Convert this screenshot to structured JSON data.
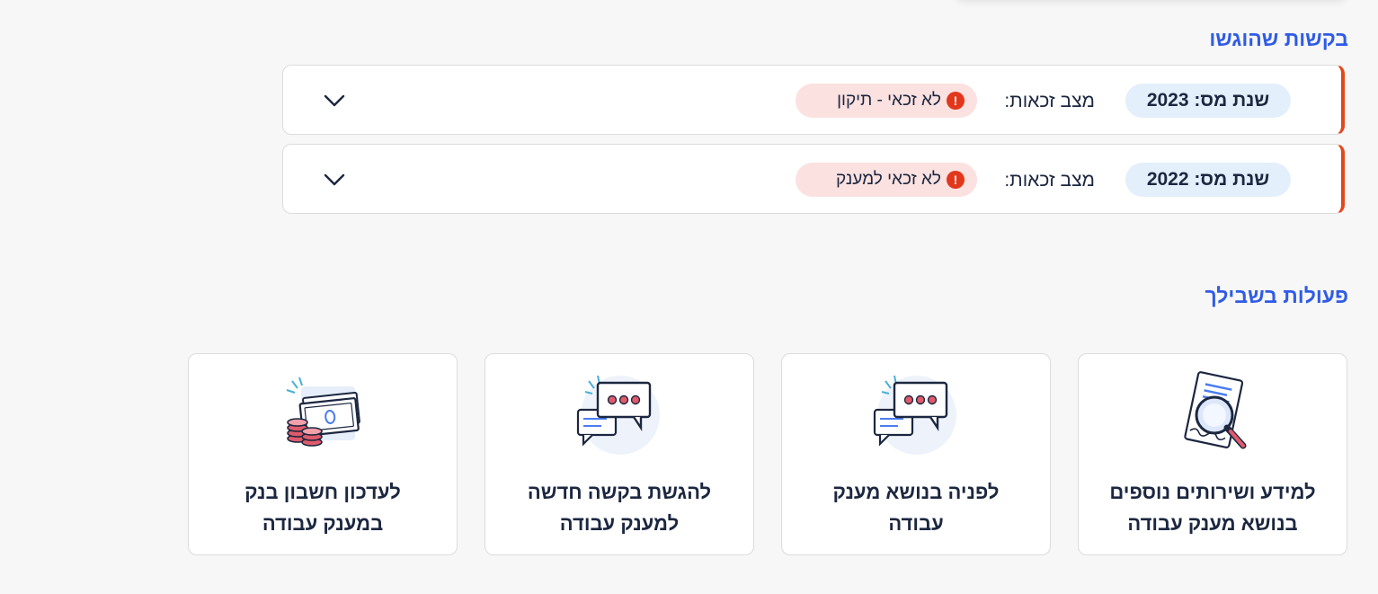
{
  "requests_section": {
    "title": "בקשות שהוגשו"
  },
  "requests": [
    {
      "year_label": "שנת מס:",
      "year": "2023",
      "status_label": "מצב זכאות:",
      "status": "לא זכאי - תיקון"
    },
    {
      "year_label": "שנת מס:",
      "year": "2022",
      "status_label": "מצב זכאות:",
      "status": "לא זכאי למענק"
    }
  ],
  "actions_section": {
    "title": "פעולות בשבילך"
  },
  "actions": [
    {
      "line1": "למידע ושירותים נוספים",
      "line2": "בנושא מענק עבודה",
      "icon": "document-search-icon"
    },
    {
      "line1": "לפניה בנושא מענק",
      "line2": "עבודה",
      "icon": "chat-bubbles-icon"
    },
    {
      "line1": "להגשת בקשה חדשה",
      "line2": "למענק עבודה",
      "icon": "chat-bubbles-icon"
    },
    {
      "line1": "לעדכון חשבון בנק",
      "line2": "במענק עבודה",
      "icon": "money-coins-icon"
    }
  ],
  "colors": {
    "accent_blue": "#2f5be6",
    "error_red": "#e2371b",
    "badge_bg": "#fbe1e0",
    "pill_bg": "#e3effb"
  }
}
